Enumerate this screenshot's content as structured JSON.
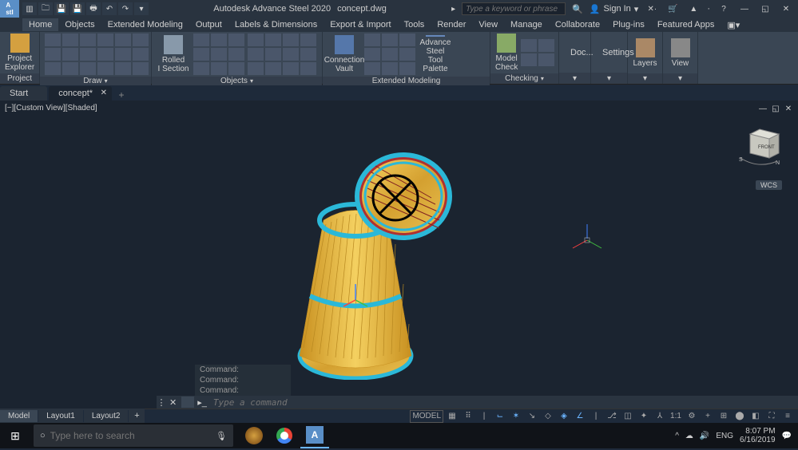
{
  "app": {
    "name": "Autodesk Advance Steel 2020",
    "document": "concept.dwg",
    "search_placeholder": "Type a keyword or phrase",
    "signin": "Sign In"
  },
  "menu": [
    "Home",
    "Objects",
    "Extended Modeling",
    "Output",
    "Labels & Dimensions",
    "Export & Import",
    "Tools",
    "Render",
    "View",
    "Manage",
    "Collaborate",
    "Plug-ins",
    "Featured Apps"
  ],
  "ribbon": {
    "project": {
      "title": "Project",
      "btn": "Project\nExplorer"
    },
    "draw": {
      "title": "Draw"
    },
    "objects": {
      "title": "Objects",
      "rolled": "Rolled\nI Section"
    },
    "extmodel": {
      "title": "Extended Modeling",
      "conn": "Connection\nVault",
      "steel": "Advance Steel\nTool Palette"
    },
    "checking": {
      "title": "Checking",
      "model": "Model\nCheck"
    },
    "doc": "Doc...",
    "settings": "Settings",
    "layers": "Layers",
    "view": "View"
  },
  "doctabs": {
    "start": "Start",
    "concept": "concept*"
  },
  "viewport": {
    "label": "[−][Custom View][Shaded]",
    "wcs": "WCS"
  },
  "command": {
    "history": [
      "Command:",
      "Command:",
      "Command:"
    ],
    "placeholder": "Type a command"
  },
  "layouts": [
    "Model",
    "Layout1",
    "Layout2"
  ],
  "status": {
    "model": "MODEL",
    "scale": "1:1"
  },
  "taskbar": {
    "search_placeholder": "Type here to search",
    "lang": "ENG",
    "sound": "🔊",
    "time": "8:07 PM",
    "date": "6/16/2019"
  }
}
